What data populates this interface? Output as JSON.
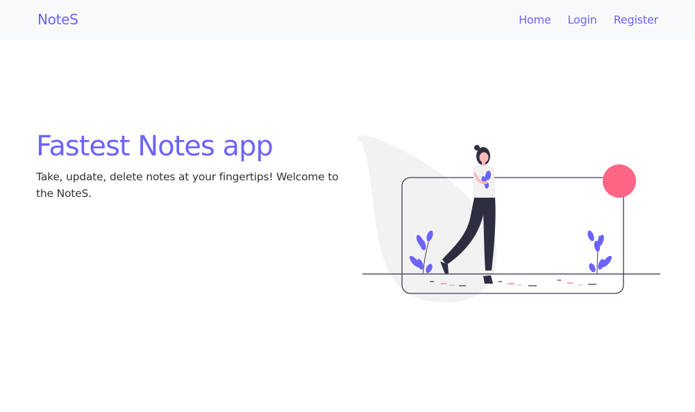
{
  "navbar": {
    "brand": "NoteS",
    "links": [
      {
        "label": "Home"
      },
      {
        "label": "Login"
      },
      {
        "label": "Register"
      }
    ]
  },
  "hero": {
    "title": "Fastest Notes app",
    "text": "Take, update, delete notes at your fingertips! Welcome to the NoteS."
  },
  "illustration": {
    "icon": "woman-walking-with-note-illustration",
    "colors": {
      "accent": "#6c63ff",
      "circle": "#ff6584",
      "blob": "#f2f2f2",
      "dark": "#2f2e41"
    }
  }
}
